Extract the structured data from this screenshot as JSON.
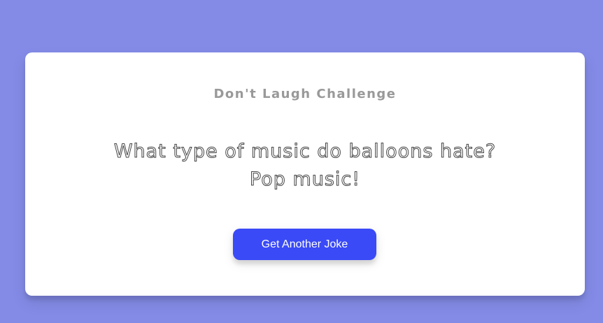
{
  "card": {
    "title": "Don't Laugh Challenge",
    "joke_line_1": "What type of music do balloons hate?",
    "joke_line_2": "Pop music!",
    "button_label": "Get Another Joke"
  },
  "colors": {
    "background": "#838be6",
    "card": "#ffffff",
    "title": "#999999",
    "button": "#3a4af7",
    "button_text": "#ffffff"
  }
}
